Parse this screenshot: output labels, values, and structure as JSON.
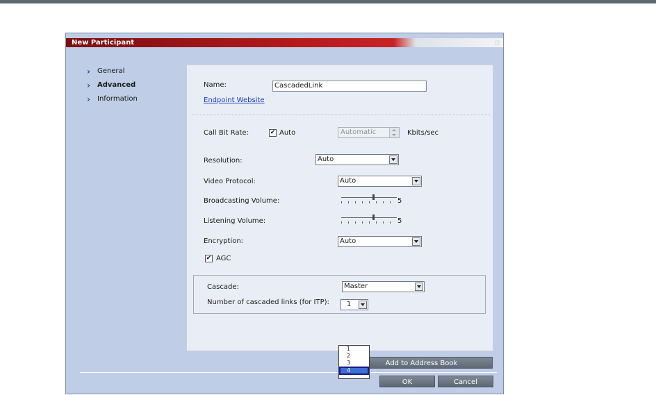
{
  "dialog": {
    "title": "New Participant",
    "close_label": "x"
  },
  "nav": {
    "items": [
      {
        "label": "General",
        "active": false
      },
      {
        "label": "Advanced",
        "active": true
      },
      {
        "label": "Information",
        "active": false
      }
    ]
  },
  "form": {
    "name_label": "Name:",
    "name_value": "CascadedLink",
    "endpoint_link": "Endpoint Website",
    "call_bit_rate_label": "Call Bit Rate:",
    "auto_checkbox_label": "Auto",
    "auto_checked": true,
    "bit_rate_value": "Automatic",
    "bit_rate_unit": "Kbits/sec",
    "resolution_label": "Resolution:",
    "resolution_value": "Auto",
    "video_protocol_label": "Video Protocol:",
    "video_protocol_value": "Auto",
    "broadcasting_volume_label": "Broadcasting Volume:",
    "broadcasting_volume_value": "5",
    "listening_volume_label": "Listening Volume:",
    "listening_volume_value": "5",
    "encryption_label": "Encryption:",
    "encryption_value": "Auto",
    "agc_label": "AGC",
    "agc_checked": true,
    "cascade_label": "Cascade:",
    "cascade_value": "Master",
    "cascaded_links_label": "Number of cascaded links (for ITP):",
    "cascaded_links_value": "1",
    "cascaded_links_options": [
      "1",
      "2",
      "3",
      "4"
    ],
    "cascaded_links_highlighted": "4"
  },
  "buttons": {
    "add_to_address_book": "Add to Address Book",
    "ok": "OK",
    "cancel": "Cancel"
  },
  "icons": {
    "check": "✔",
    "chevron": "›"
  }
}
